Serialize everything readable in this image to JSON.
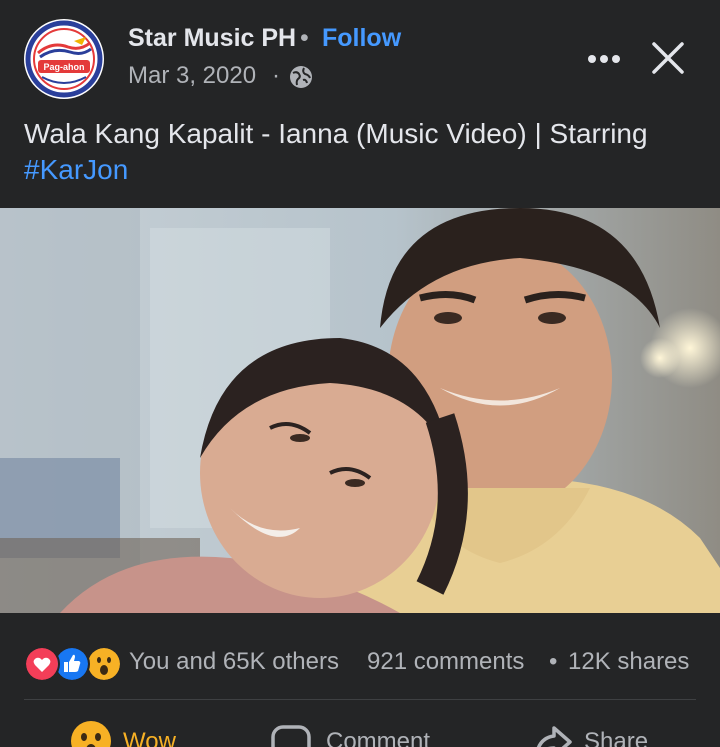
{
  "post": {
    "page_name": "Star Music PH",
    "separator": "•",
    "follow_label": "Follow",
    "date": "Mar 3, 2020",
    "date_separator": "·",
    "privacy_icon": "globe-icon",
    "caption_text": "Wala Kang Kapalit - Ianna (Music Video) | Starring",
    "caption_hashtag": "#KarJon",
    "avatar_logo_text": "Pag-ahon"
  },
  "reactions": {
    "icons": [
      "love-reaction-icon",
      "like-reaction-icon",
      "wow-reaction-icon"
    ],
    "summary": "You and 65K others",
    "comments": "921 comments",
    "dot": "•",
    "shares": "12K shares"
  },
  "actions": {
    "reaction_label": "Wow",
    "comment_label": "Comment",
    "share_label": "Share"
  },
  "colors": {
    "background": "#242526",
    "primary_text": "#e4e6eb",
    "secondary_text": "#b0b3b8",
    "link_blue": "#4599ff",
    "wow_yellow": "#f7b125",
    "love_red": "#f33e58",
    "like_blue": "#1877f2"
  }
}
